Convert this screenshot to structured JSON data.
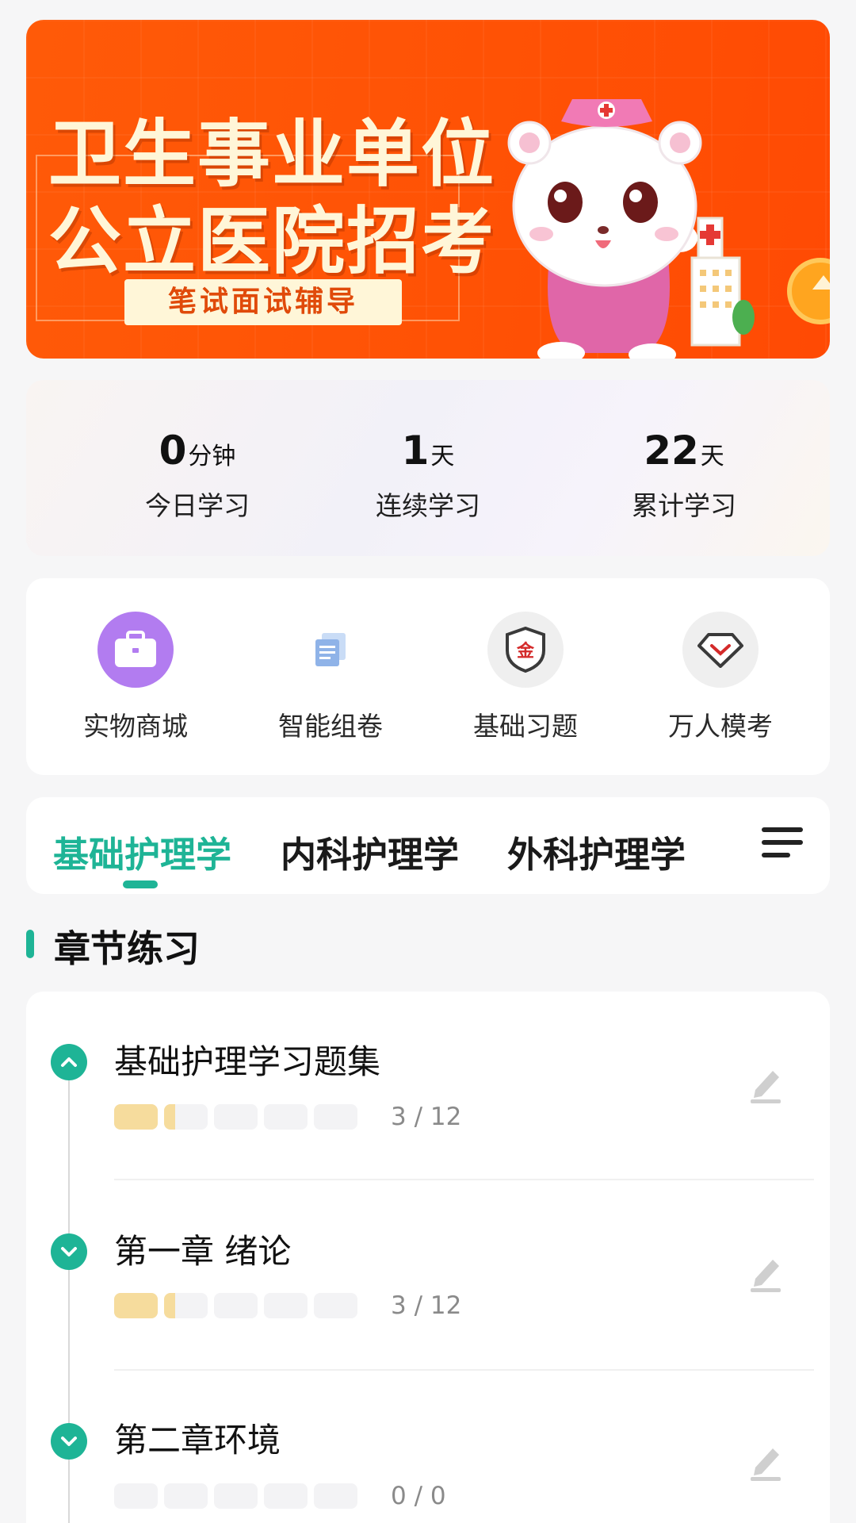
{
  "banner": {
    "headline_line1": "卫生事业单位",
    "headline_line2": "公立医院招考",
    "subtitle": "笔试面试辅导"
  },
  "stats": [
    {
      "value": "0",
      "unit": "分钟",
      "label": "今日学习"
    },
    {
      "value": "1",
      "unit": "天",
      "label": "连续学习"
    },
    {
      "value": "22",
      "unit": "天",
      "label": "累计学习"
    }
  ],
  "actions": [
    {
      "label": "实物商城",
      "icon": "briefcase-icon",
      "color": "#b27cf0"
    },
    {
      "label": "智能组卷",
      "icon": "documents-icon",
      "color": "#6a96d8"
    },
    {
      "label": "基础习题",
      "icon": "gold-shield-icon",
      "color": "#d42a2a",
      "glyph": "金"
    },
    {
      "label": "万人模考",
      "icon": "diamond-icon",
      "color": "#d42a2a"
    }
  ],
  "tabs": [
    {
      "label": "基础护理学",
      "active": true
    },
    {
      "label": "内科护理学",
      "active": false
    },
    {
      "label": "外科护理学",
      "active": false
    }
  ],
  "section": {
    "title": "章节练习"
  },
  "chapters": [
    {
      "title": "基础护理学习题集",
      "count": "3 / 12",
      "progress": 0.25,
      "expanded": true
    },
    {
      "title": "第一章  绪论",
      "count": "3 / 12",
      "progress": 0.25,
      "expanded": false
    },
    {
      "title": "第二章环境",
      "count": "0 / 0",
      "progress": 0,
      "expanded": false
    }
  ],
  "colors": {
    "accent": "#1eb496",
    "banner": "#ff5205",
    "progress_fill": "#f6dc9d"
  }
}
